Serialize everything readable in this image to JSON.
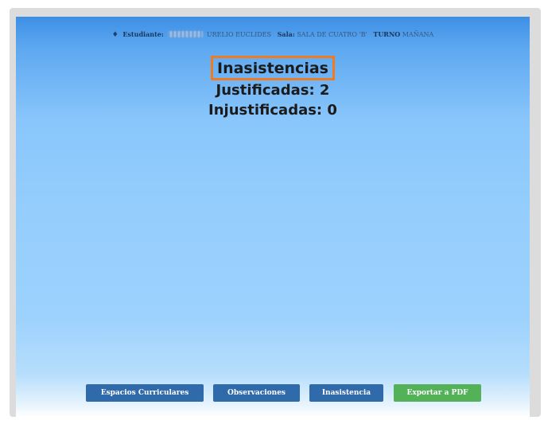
{
  "student_bar": {
    "icon": "person-icon",
    "student_label": "Estudiante:",
    "student_name_visible": "URELIO EUCLIDES",
    "classroom_label": "Sala:",
    "classroom_value": "SALA DE CUATRO 'B'",
    "shift_label": "TURNO",
    "shift_value": "MAÑANA"
  },
  "absences": {
    "title": "Inasistencias",
    "justified": "Justificadas: 2",
    "unjustified": "Injustificadas: 0"
  },
  "buttons": {
    "curricular": "Espacios Curriculares",
    "observations": "Observaciones",
    "absence": "Inasistencia",
    "export_pdf": "Exportar a PDF"
  },
  "colors": {
    "panel_top": "#3d8fe6",
    "panel_mid": "#93cdfd",
    "button_blue": "#2f6aab",
    "button_green": "#53b257",
    "highlight_box": "#ee7a22"
  }
}
